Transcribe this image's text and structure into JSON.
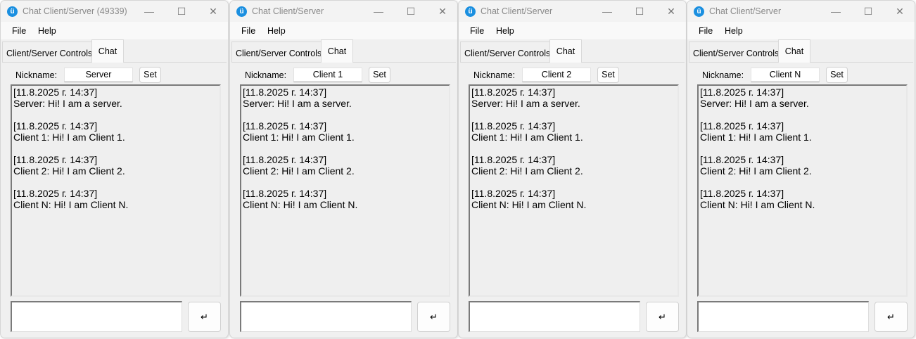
{
  "windows": [
    {
      "title": "Chat Client/Server (49339)",
      "nickname": "Server"
    },
    {
      "title": "Chat Client/Server",
      "nickname": "Client 1"
    },
    {
      "title": "Chat Client/Server",
      "nickname": "Client 2"
    },
    {
      "title": "Chat Client/Server",
      "nickname": "Client N"
    }
  ],
  "menu": {
    "file": "File",
    "help": "Help"
  },
  "tabs": {
    "controls": "Client/Server Controls",
    "chat": "Chat"
  },
  "nickname_label": "Nickname:",
  "set_label": "Set",
  "send_icon": "↵",
  "window_controls": {
    "minimize": "—",
    "maximize": "☐",
    "close": "✕"
  },
  "app_icon": "ü",
  "messages": [
    {
      "timestamp": "[11.8.2025 г. 14:37]",
      "text": "Server: Hi! I am a server."
    },
    {
      "timestamp": "[11.8.2025 г. 14:37]",
      "text": "Client 1: Hi! I am Client 1."
    },
    {
      "timestamp": "[11.8.2025 г. 14:37]",
      "text": "Client 2: Hi! I am Client 2."
    },
    {
      "timestamp": "[11.8.2025 г. 14:37]",
      "text": "Client N: Hi! I am Client N."
    }
  ]
}
